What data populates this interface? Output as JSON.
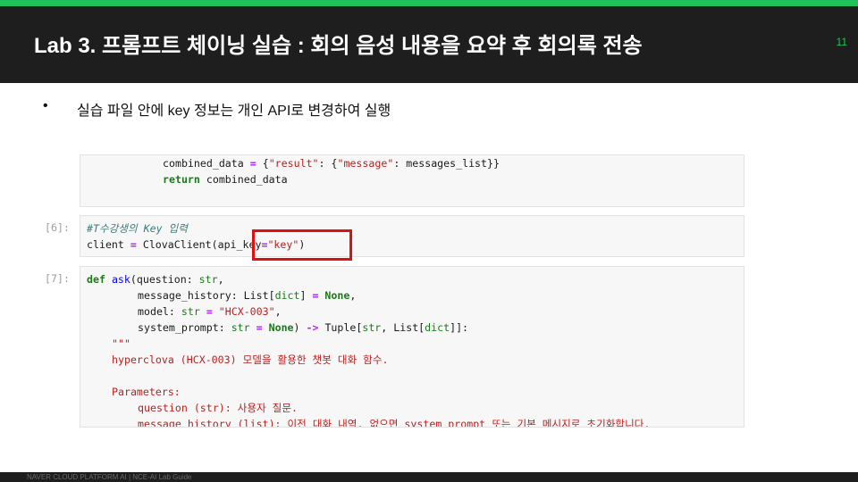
{
  "header": {
    "title": "Lab 3. 프롬프트 체이닝 실습 : 회의 음성 내용을 요약 후 회의록 전송",
    "page_number": "11"
  },
  "bullet": {
    "dot": "•",
    "text": "실습 파일 안에 key 정보는 개인 API로 변경하여 실행"
  },
  "cells": [
    {
      "prompt": "",
      "lines": [
        "combined_data = {\"result\": {\"message\": messages_list}}",
        "return combined_data"
      ]
    },
    {
      "prompt": "[6]:",
      "lines": [
        "#T수강생의 Key 입력",
        "client = ClovaClient(api_key=\"key\")"
      ]
    },
    {
      "prompt": "[7]:",
      "lines": [
        "def ask(question: str,",
        "message_history: List[dict] = None,",
        "model: str = \"HCX-003\",",
        "system_prompt: str = None) -> Tuple[str, List[dict]]:",
        "\"\"\"",
        "hyperclova (HCX-003) 모델을 활용한 챗봇 대화 함수.",
        "Parameters:",
        "question (str): 사용자 질문.",
        "message_history (list): 이전 대화 내역. 없으면 system_prompt 또는 기본 메시지로 초기화합니다."
      ]
    }
  ],
  "footer": {
    "text": "NAVER CLOUD PLATFORM AI  |  NCE-AI Lab Guide"
  },
  "colors": {
    "accent": "#20c35a",
    "header_bg": "#1e1e1e",
    "highlight": "#e01010"
  }
}
